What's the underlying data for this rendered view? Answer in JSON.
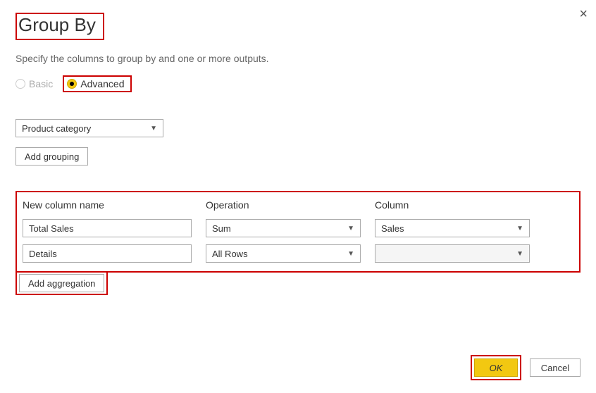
{
  "title": "Group By",
  "subtitle": "Specify the columns to group by and one or more outputs.",
  "mode": {
    "basic_label": "Basic",
    "advanced_label": "Advanced",
    "selected": "advanced"
  },
  "grouping": {
    "column_select": "Product category",
    "add_button": "Add grouping"
  },
  "aggregations": {
    "headers": {
      "name": "New column name",
      "operation": "Operation",
      "column": "Column"
    },
    "rows": [
      {
        "name": "Total Sales",
        "operation": "Sum",
        "column": "Sales"
      },
      {
        "name": "Details",
        "operation": "All Rows",
        "column": ""
      }
    ],
    "add_button": "Add aggregation"
  },
  "footer": {
    "ok": "OK",
    "cancel": "Cancel"
  },
  "colors": {
    "accent": "#f2c811",
    "highlight": "#c00"
  }
}
